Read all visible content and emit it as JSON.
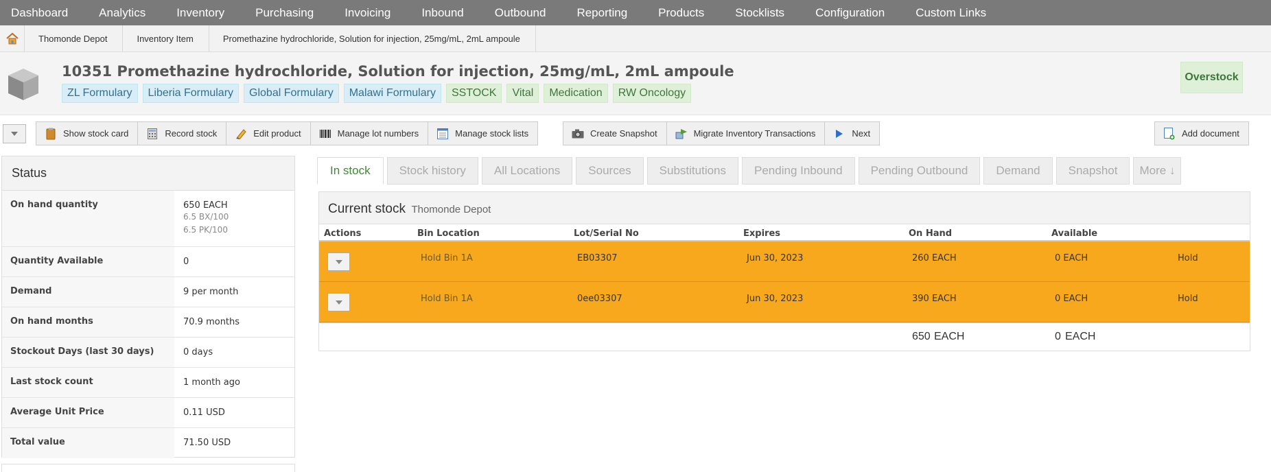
{
  "nav": {
    "items": [
      "Dashboard",
      "Analytics",
      "Inventory",
      "Purchasing",
      "Invoicing",
      "Inbound",
      "Outbound",
      "Reporting",
      "Products",
      "Stocklists",
      "Configuration",
      "Custom Links"
    ]
  },
  "breadcrumb": {
    "items": [
      "Thomonde Depot",
      "Inventory Item",
      "Promethazine hydrochloride, Solution for injection, 25mg/mL, 2mL ampoule"
    ]
  },
  "product": {
    "title": "10351 Promethazine hydrochloride, Solution for injection, 25mg/mL, 2mL ampoule",
    "tags": [
      {
        "label": "ZL Formulary",
        "color": "blue"
      },
      {
        "label": "Liberia Formulary",
        "color": "blue"
      },
      {
        "label": "Global Formulary",
        "color": "blue"
      },
      {
        "label": "Malawi Formulary",
        "color": "blue"
      },
      {
        "label": "SSTOCK",
        "color": "green"
      },
      {
        "label": "Vital",
        "color": "green"
      },
      {
        "label": "Medication",
        "color": "green"
      },
      {
        "label": "RW Oncology",
        "color": "green"
      }
    ],
    "status_badge": "Overstock"
  },
  "toolbar": {
    "show_stock_card": "Show stock card",
    "record_stock": "Record stock",
    "edit_product": "Edit product",
    "manage_lot_numbers": "Manage lot numbers",
    "manage_stock_lists": "Manage stock lists",
    "create_snapshot": "Create Snapshot",
    "migrate_inventory": "Migrate Inventory Transactions",
    "next": "Next",
    "add_document": "Add document"
  },
  "status": {
    "title": "Status",
    "rows": [
      {
        "label": "On hand quantity",
        "value": "650 EACH",
        "subs": [
          "6.5 BX/100",
          "6.5 PK/100"
        ]
      },
      {
        "label": "Quantity Available",
        "value": "0"
      },
      {
        "label": "Demand",
        "value": "9 per month"
      },
      {
        "label": "On hand months",
        "value": "70.9 months"
      },
      {
        "label": "Stockout Days (last 30 days)",
        "value": "0 days"
      },
      {
        "label": "Last stock count",
        "value": "1 month ago"
      },
      {
        "label": "Average Unit Price",
        "value": "0.11 USD"
      },
      {
        "label": "Total value",
        "value": "71.50 USD"
      }
    ]
  },
  "tabs": [
    "In stock",
    "Stock history",
    "All Locations",
    "Sources",
    "Substitutions",
    "Pending Inbound",
    "Pending Outbound",
    "Demand",
    "Snapshot",
    "More ↓"
  ],
  "stock": {
    "title": "Current stock",
    "location": "Thomonde Depot",
    "columns": {
      "actions": "Actions",
      "bin": "Bin Location",
      "lot": "Lot/Serial No",
      "expires": "Expires",
      "on_hand": "On Hand",
      "available": "Available"
    },
    "rows": [
      {
        "bin": "Hold Bin 1A",
        "lot": "EB03307",
        "expires": "Jun 30, 2023",
        "on_hand": "260 EACH",
        "available": "0 EACH",
        "status": "Hold"
      },
      {
        "bin": "Hold Bin 1A",
        "lot": "0ee03307",
        "expires": "Jun 30, 2023",
        "on_hand": "390 EACH",
        "available": "0 EACH",
        "status": "Hold"
      }
    ],
    "total_on_hand_qty": "650",
    "total_on_hand_unit": "EACH",
    "total_available_qty": "0",
    "total_available_unit": "EACH"
  },
  "colors": {
    "nav_bg": "#7a7a7a",
    "row_highlight": "#f8a81c",
    "active_tab": "#3b8b2e"
  }
}
